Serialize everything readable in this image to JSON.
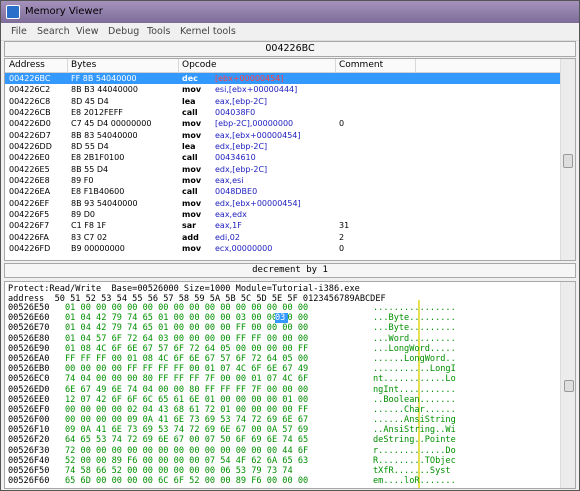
{
  "window": {
    "title": "Memory Viewer",
    "icon": "memory-viewer-icon"
  },
  "menu": [
    "File",
    "Search",
    "View",
    "Debug",
    "Tools",
    "Kernel tools"
  ],
  "address_bar": "004226BC",
  "disasm": {
    "columns": [
      "Address",
      "Bytes",
      "Opcode",
      "Comment"
    ],
    "rows": [
      {
        "addr": "004226BC",
        "bytes": "FF 8B 54040000",
        "op": "dec",
        "args": "[ebx+00000454]",
        "cmt": "",
        "sel": true,
        "red": true
      },
      {
        "addr": "004226C2",
        "bytes": "8B B3 44040000",
        "op": "mov",
        "args": "esi,[ebx+00000444]",
        "cmt": "",
        "red": false
      },
      {
        "addr": "004226C8",
        "bytes": "8D 45 D4",
        "op": "lea",
        "args": "eax,[ebp-2C]",
        "cmt": "",
        "red": false
      },
      {
        "addr": "004226CB",
        "bytes": "E8 2012FEFF",
        "op": "call",
        "args": "004038F0",
        "cmt": "",
        "red": false
      },
      {
        "addr": "004226D0",
        "bytes": "C7 45 D4 00000000",
        "op": "mov",
        "args": "[ebp-2C],00000000",
        "cmt": "0",
        "red": false
      },
      {
        "addr": "004226D7",
        "bytes": "8B 83 54040000",
        "op": "mov",
        "args": "eax,[ebx+00000454]",
        "cmt": "",
        "red": false
      },
      {
        "addr": "004226DD",
        "bytes": "8D 55 D4",
        "op": "lea",
        "args": "edx,[ebp-2C]",
        "cmt": "",
        "red": false
      },
      {
        "addr": "004226E0",
        "bytes": "E8 2B1F0100",
        "op": "call",
        "args": "00434610",
        "cmt": "",
        "red": false
      },
      {
        "addr": "004226E5",
        "bytes": "8B 55 D4",
        "op": "mov",
        "args": "edx,[ebp-2C]",
        "cmt": "",
        "red": false
      },
      {
        "addr": "004226E8",
        "bytes": "89 F0",
        "op": "mov",
        "args": "eax,esi",
        "cmt": "",
        "red": false
      },
      {
        "addr": "004226EA",
        "bytes": "E8 F1B40600",
        "op": "call",
        "args": "0048DBE0",
        "cmt": "",
        "red": false
      },
      {
        "addr": "004226EF",
        "bytes": "8B 93 54040000",
        "op": "mov",
        "args": "edx,[ebx+00000454]",
        "cmt": "",
        "red": false
      },
      {
        "addr": "004226F5",
        "bytes": "89 D0",
        "op": "mov",
        "args": "eax,edx",
        "cmt": "",
        "red": false
      },
      {
        "addr": "004226F7",
        "bytes": "C1 F8 1F",
        "op": "sar",
        "args": "eax,1F",
        "cmt": "31",
        "red": false
      },
      {
        "addr": "004226FA",
        "bytes": "83 C7 02",
        "op": "add",
        "args": "edi,02",
        "cmt": "2",
        "red": false
      },
      {
        "addr": "004226FD",
        "bytes": "B9 00000000",
        "op": "mov",
        "args": "ecx,00000000",
        "cmt": "0",
        "red": false
      }
    ]
  },
  "status_line": "decrement by 1",
  "hex": {
    "header": "Protect:Read/Write  Base=00526000 Size=1000 Module=Tutorial-i386.exe",
    "columns": "address  50 51 52 53 54 55 56 57 58 59 5A 5B 5C 5D 5E 5F 0123456789ABCDEF",
    "cursor_byte": "03",
    "rows": [
      {
        "addr": "00526E50",
        "bytes": "01 00 00 00 00 00 00 00 00 00 00 00 00 00 00 00",
        "ascii": "................"
      },
      {
        "addr": "00526E60",
        "bytes": "01 04 42 79 74 65 01 00 00 00 00 03 00 00 00 00",
        "ascii": "...Byte........."
      },
      {
        "addr": "00526E70",
        "bytes": "01 04 42 79 74 65 01 00 00 00 00 FF 00 00 00 00",
        "ascii": "...Byte........."
      },
      {
        "addr": "00526E80",
        "bytes": "01 04 57 6F 72 64 03 00 00 00 00 FF FF 00 00 00",
        "ascii": "...Word........."
      },
      {
        "addr": "00526E90",
        "bytes": "01 08 4C 6F 6E 67 57 6F 72 64 05 00 00 00 00 FF",
        "ascii": "...LongWord....."
      },
      {
        "addr": "00526EA0",
        "bytes": "FF FF FF 00 01 08 4C 6F 6E 67 57 6F 72 64 05 00",
        "ascii": "......LongWord.."
      },
      {
        "addr": "00526EB0",
        "bytes": "00 00 00 00 FF FF FF FF 00 01 07 4C 6F 6E 67 49",
        "ascii": "...........LongI"
      },
      {
        "addr": "00526EC0",
        "bytes": "74 04 00 00 00 80 FF FF FF 7F 00 00 01 07 4C 6F",
        "ascii": "nt............Lo"
      },
      {
        "addr": "00526ED0",
        "bytes": "6E 67 49 6E 74 04 00 00 80 FF FF FF 7F 00 00 00",
        "ascii": "ngInt..........."
      },
      {
        "addr": "00526EE0",
        "bytes": "12 07 42 6F 6F 6C 65 61 6E 01 00 00 00 00 01 00",
        "ascii": "..Boolean......."
      },
      {
        "addr": "00526EF0",
        "bytes": "00 00 00 00 02 04 43 68 61 72 01 00 00 00 00 FF",
        "ascii": "......Char......"
      },
      {
        "addr": "00526F00",
        "bytes": "00 00 00 00 09 0A 41 6E 73 69 53 74 72 69 6E 67",
        "ascii": "......AnsiString"
      },
      {
        "addr": "00526F10",
        "bytes": "09 0A 41 6E 73 69 53 74 72 69 6E 67 00 0A 57 69",
        "ascii": "..AnsiString..Wi"
      },
      {
        "addr": "00526F20",
        "bytes": "64 65 53 74 72 69 6E 67 00 07 50 6F 69 6E 74 65",
        "ascii": "deString..Pointe"
      },
      {
        "addr": "00526F30",
        "bytes": "72 00 00 00 00 00 00 00 00 00 00 00 00 00 44 6F",
        "ascii": "r.............Do"
      },
      {
        "addr": "00526F40",
        "bytes": "52 00 00 89 F6 00 00 00 00 07 54 4F 62 6A 65 63",
        "ascii": "R.........TObjec"
      },
      {
        "addr": "00526F50",
        "bytes": "74 58 66 52 00 00 00 00 00 00 06 53 79 73 74",
        "ascii": "tXfR.......Syst"
      },
      {
        "addr": "00526F60",
        "bytes": "65 6D 00 00 00 00 6C 6F 52 00 00 89 F6 00 00 00",
        "ascii": "em....loR......."
      }
    ]
  }
}
